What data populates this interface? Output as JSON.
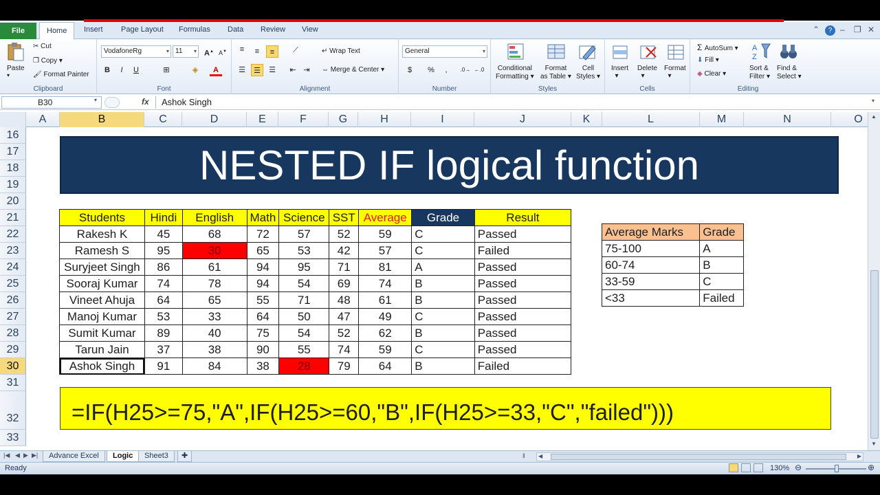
{
  "ribbon": {
    "file_tab": "File",
    "tabs": [
      "Home",
      "Insert",
      "Page Layout",
      "Formulas",
      "Data",
      "Review",
      "View"
    ],
    "clipboard": {
      "paste": "Paste",
      "cut": "Cut",
      "copy": "Copy",
      "format_painter": "Format Painter",
      "label": "Clipboard"
    },
    "font": {
      "name": "VodafoneRg",
      "size": "11",
      "label": "Font"
    },
    "alignment": {
      "wrap": "Wrap Text",
      "merge": "Merge & Center",
      "label": "Alignment"
    },
    "number": {
      "format": "General",
      "label": "Number"
    },
    "styles": {
      "conditional": "Conditional Formatting",
      "cond_line1": "Conditional",
      "cond_line2": "Formatting",
      "table_line1": "Format",
      "table_line2": "as Table",
      "cell_line1": "Cell",
      "cell_line2": "Styles",
      "label": "Styles"
    },
    "cells": {
      "insert": "Insert",
      "delete": "Delete",
      "format": "Format",
      "label": "Cells"
    },
    "editing": {
      "autosum": "AutoSum",
      "fill": "Fill",
      "clear": "Clear",
      "sort_line1": "Sort &",
      "sort_line2": "Filter",
      "find_line1": "Find &",
      "find_line2": "Select",
      "label": "Editing"
    }
  },
  "formula_bar": {
    "name_box": "B30",
    "fx": "fx",
    "value": "Ashok Singh"
  },
  "columns": [
    "A",
    "B",
    "C",
    "D",
    "E",
    "F",
    "G",
    "H",
    "I",
    "J",
    "K",
    "L",
    "M",
    "N",
    "O"
  ],
  "rows": [
    "16",
    "17",
    "18",
    "19",
    "20",
    "21",
    "22",
    "23",
    "24",
    "25",
    "26",
    "27",
    "28",
    "29",
    "30",
    "31",
    "32",
    "33"
  ],
  "banner": "NESTED IF logical function",
  "table": {
    "headers": [
      "Students",
      "Hindi",
      "English",
      "Math",
      "Science",
      "SST",
      "Average",
      "Grade",
      "Result"
    ],
    "rows": [
      [
        "Rakesh K",
        "45",
        "68",
        "72",
        "57",
        "52",
        "59",
        "C",
        "Passed"
      ],
      [
        "Ramesh S",
        "95",
        "30",
        "65",
        "53",
        "42",
        "57",
        "C",
        "Failed"
      ],
      [
        "Suryjeet Singh",
        "86",
        "61",
        "94",
        "95",
        "71",
        "81",
        "A",
        "Passed"
      ],
      [
        "Sooraj Kumar",
        "74",
        "78",
        "94",
        "54",
        "69",
        "74",
        "B",
        "Passed"
      ],
      [
        "Vineet Ahuja",
        "64",
        "65",
        "55",
        "71",
        "48",
        "61",
        "B",
        "Passed"
      ],
      [
        "Manoj Kumar",
        "53",
        "33",
        "64",
        "50",
        "47",
        "49",
        "C",
        "Passed"
      ],
      [
        "Sumit Kumar",
        "89",
        "40",
        "75",
        "54",
        "52",
        "62",
        "B",
        "Passed"
      ],
      [
        "Tarun Jain",
        "37",
        "38",
        "90",
        "55",
        "74",
        "59",
        "C",
        "Passed"
      ],
      [
        "Ashok Singh",
        "91",
        "84",
        "38",
        "28",
        "79",
        "64",
        "B",
        "Failed"
      ]
    ]
  },
  "grade_table": {
    "headers": [
      "Average Marks",
      "Grade"
    ],
    "rows": [
      [
        "75-100",
        "A"
      ],
      [
        "60-74",
        "B"
      ],
      [
        "33-59",
        "C"
      ],
      [
        "<33",
        "Failed"
      ]
    ]
  },
  "formula_text": "=IF(H25>=75,\"A\",IF(H25>=60,\"B\",IF(H25>=33,\"C\",\"failed\")))",
  "sheets": [
    "Advance Excel",
    "Logic",
    "Sheet3"
  ],
  "status": {
    "ready": "Ready",
    "zoom": "130%"
  },
  "colors": {
    "header_yellow": "#ffff00",
    "banner_navy": "#17375e",
    "fail_red": "#ff0000",
    "grade_orange": "#fac090",
    "file_green": "#2a8a3b"
  }
}
